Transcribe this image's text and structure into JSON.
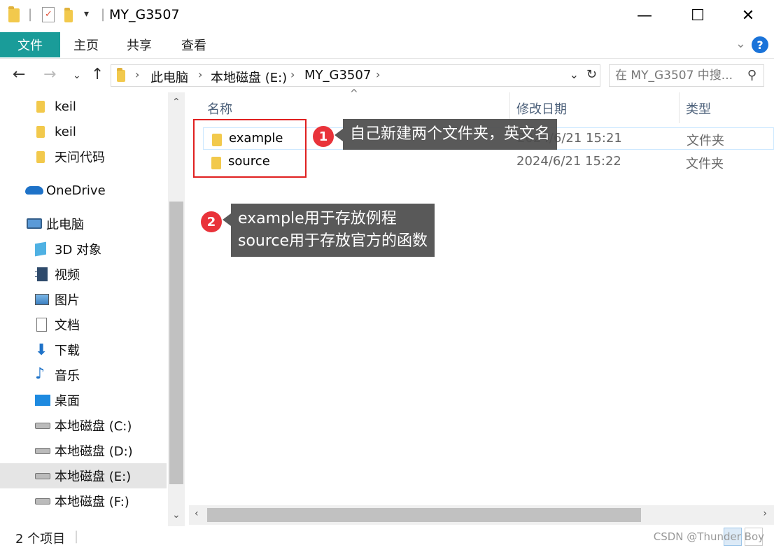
{
  "window": {
    "title": "MY_G3507",
    "controls": {
      "minimize": "—",
      "maximize": "☐",
      "close": "✕"
    }
  },
  "ribbon": {
    "tabs": [
      {
        "label": "文件",
        "active": true
      },
      {
        "label": "主页"
      },
      {
        "label": "共享"
      },
      {
        "label": "查看"
      }
    ],
    "help_label": "?"
  },
  "address_bar": {
    "breadcrumbs": [
      "此电脑",
      "本地磁盘 (E:)",
      "MY_G3507"
    ]
  },
  "search": {
    "placeholder": "在 MY_G3507 中搜..."
  },
  "nav_pane": {
    "items": [
      {
        "label": "keil",
        "icon": "folder-icon"
      },
      {
        "label": "keil",
        "icon": "folder-icon"
      },
      {
        "label": "天问代码",
        "icon": "folder-icon"
      },
      {
        "label": "OneDrive",
        "icon": "cloud-icon"
      },
      {
        "label": "此电脑",
        "icon": "computer-icon"
      },
      {
        "label": "3D 对象",
        "icon": "cube-icon"
      },
      {
        "label": "视频",
        "icon": "video-icon"
      },
      {
        "label": "图片",
        "icon": "picture-icon"
      },
      {
        "label": "文档",
        "icon": "document-icon"
      },
      {
        "label": "下载",
        "icon": "download-icon"
      },
      {
        "label": "音乐",
        "icon": "music-icon"
      },
      {
        "label": "桌面",
        "icon": "desktop-icon"
      },
      {
        "label": "本地磁盘 (C:)",
        "icon": "drive-icon"
      },
      {
        "label": "本地磁盘 (D:)",
        "icon": "drive-icon"
      },
      {
        "label": "本地磁盘 (E:)",
        "icon": "drive-icon",
        "selected": true
      },
      {
        "label": "本地磁盘 (F:)",
        "icon": "drive-icon"
      }
    ]
  },
  "file_list": {
    "columns": [
      "名称",
      "修改日期",
      "类型"
    ],
    "rows": [
      {
        "name": "example",
        "modified": "2024/6/21 15:21",
        "type": "文件夹",
        "selected": true
      },
      {
        "name": "source",
        "modified": "2024/6/21 15:22",
        "type": "文件夹"
      }
    ]
  },
  "annotations": {
    "callout1": {
      "number": "1",
      "text": "自己新建两个文件夹，英文名"
    },
    "callout2": {
      "number": "2",
      "line1": "example用于存放例程",
      "line2": "source用于存放官方的函数"
    }
  },
  "status_bar": {
    "item_count": "2 个项目",
    "watermark": "CSDN @Thunder Boy"
  },
  "colors": {
    "file_tab": "#1a9c99",
    "annotation_red": "#e02020",
    "callout_bg": "#4c4c4c"
  }
}
